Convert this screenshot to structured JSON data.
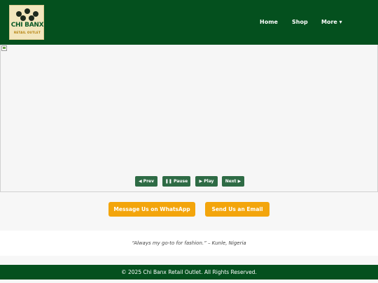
{
  "header": {
    "logo": {
      "title": "CHI BANX",
      "subtitle": "RETAIL OUTLET"
    },
    "nav": {
      "home": "Home",
      "shop": "Shop",
      "more": "More ▾"
    }
  },
  "slider": {
    "controls": {
      "prev": "◀ Prev",
      "pause": "❚❚ Pause",
      "play": "▶ Play",
      "next": "Next ▶"
    }
  },
  "cta": {
    "whatsapp": "Message Us on WhatsApp",
    "email": "Send Us an Email"
  },
  "testimonial": {
    "text": "“Always my go-to for fashion.” – Kunle, Nigeria"
  },
  "footer": {
    "text": "© 2025 Chi Banx Retail Outlet. All Rights Reserved."
  },
  "colors": {
    "primary": "#04501e",
    "button": "#2e6b45",
    "accent": "#f3a50c"
  }
}
